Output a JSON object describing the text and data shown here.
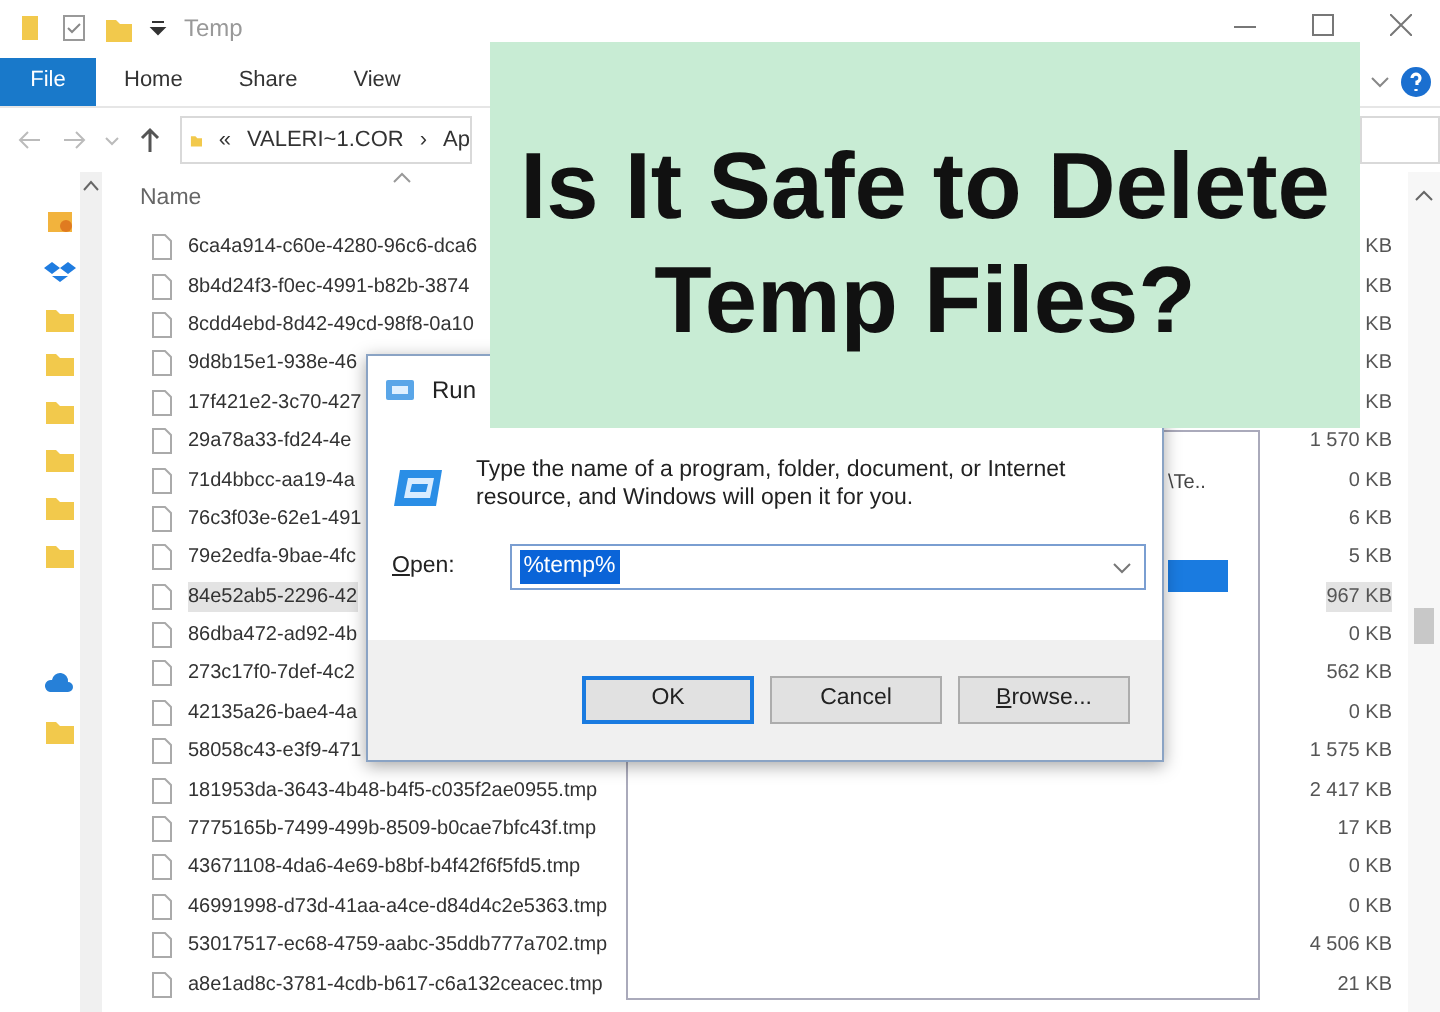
{
  "window": {
    "title": "Temp"
  },
  "ribbon_tabs": [
    {
      "label": "File",
      "kind": "file"
    },
    {
      "label": "Home",
      "kind": "tab"
    },
    {
      "label": "Share",
      "kind": "tab"
    },
    {
      "label": "View",
      "kind": "tab"
    }
  ],
  "address": {
    "parts": [
      "«",
      "VALERI~1.COR",
      "›",
      "Ap"
    ]
  },
  "file_list": {
    "columns": [
      "Name"
    ],
    "rows": [
      {
        "name": "6ca4a914-c60e-4280-96c6-dca6",
        "size": "KB",
        "selected": false
      },
      {
        "name": "8b4d24f3-f0ec-4991-b82b-3874",
        "size": "KB",
        "selected": false
      },
      {
        "name": "8cdd4ebd-8d42-49cd-98f8-0a10",
        "size": "KB",
        "selected": false
      },
      {
        "name": "9d8b15e1-938e-46",
        "size": "KB",
        "selected": false
      },
      {
        "name": "17f421e2-3c70-427",
        "size": "KB",
        "selected": false
      },
      {
        "name": "29a78a33-fd24-4e",
        "size": "1 570 KB",
        "selected": false
      },
      {
        "name": "71d4bbcc-aa19-4a",
        "size": "0 KB",
        "selected": false
      },
      {
        "name": "76c3f03e-62e1-491",
        "size": "6 KB",
        "selected": false
      },
      {
        "name": "79e2edfa-9bae-4fc",
        "size": "5 KB",
        "selected": false
      },
      {
        "name": "84e52ab5-2296-42",
        "size": "967 KB",
        "selected": true
      },
      {
        "name": "86dba472-ad92-4b",
        "size": "0 KB",
        "selected": false
      },
      {
        "name": "273c17f0-7def-4c2",
        "size": "562 KB",
        "selected": false
      },
      {
        "name": "42135a26-bae4-4a",
        "size": "0 KB",
        "selected": false
      },
      {
        "name": "58058c43-e3f9-471",
        "size": "1 575 KB",
        "selected": false
      },
      {
        "name": "181953da-3643-4b48-b4f5-c035f2ae0955.tmp",
        "size": "2 417 KB",
        "selected": false
      },
      {
        "name": "7775165b-7499-499b-8509-b0cae7bfc43f.tmp",
        "size": "17 KB",
        "selected": false
      },
      {
        "name": "43671108-4da6-4e69-b8bf-b4f42f6f5fd5.tmp",
        "size": "0 KB",
        "selected": false
      },
      {
        "name": "46991998-d73d-41aa-a4ce-d84d4c2e5363.tmp",
        "size": "0 KB",
        "selected": false
      },
      {
        "name": "53017517-ec68-4759-aabc-35ddb777a702.tmp",
        "size": "4 506 KB",
        "selected": false
      },
      {
        "name": "a8e1ad8c-3781-4cdb-b617-c6a132ceacec.tmp",
        "size": "21 KB",
        "selected": false
      }
    ]
  },
  "back_panel": {
    "text": "\\Te.."
  },
  "run_dialog": {
    "title": "Run",
    "description": "Type the name of a program, folder, document, or Internet resource, and Windows will open it for you.",
    "open_label": "Open:",
    "value": "%temp%",
    "value_selected": true,
    "buttons": [
      {
        "label": "OK",
        "default": true
      },
      {
        "label": "Cancel",
        "default": false
      },
      {
        "label": "Browse...",
        "default": false
      }
    ]
  },
  "overlay": {
    "headline": "Is It Safe to Delete\nTemp Files?"
  }
}
